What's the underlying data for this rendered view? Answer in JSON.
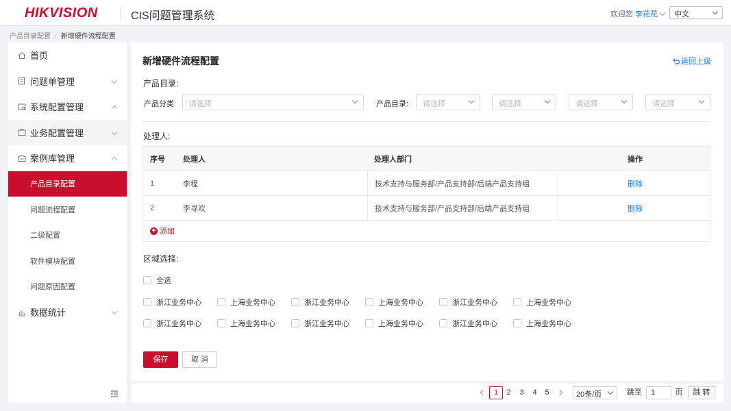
{
  "header": {
    "logo": "HIKVISION",
    "app_title": "CIS问题管理系统",
    "welcome": "欢迎您",
    "user": "李花花",
    "language": "中文"
  },
  "breadcrumb": [
    "产品目录配置",
    "新增硬件流程配置"
  ],
  "sidebar": {
    "items": [
      {
        "label": "首页",
        "icon": "home-icon"
      },
      {
        "label": "问题单管理",
        "icon": "ticket-icon"
      },
      {
        "label": "系统配置管理",
        "icon": "system-config-icon"
      },
      {
        "label": "业务配置管理",
        "icon": "business-config-icon"
      },
      {
        "label": "案例库管理",
        "icon": "case-library-icon"
      }
    ],
    "sub_items": [
      "产品目录配置",
      "问题流程配置",
      "二级配置",
      "软件模块配置",
      "问题原因配置"
    ],
    "stats": {
      "label": "数据统计",
      "icon": "chart-icon"
    }
  },
  "main": {
    "title": "新增硬件流程配置",
    "back": "返回上级",
    "product_dir_section": "产品目录:",
    "category_label": "产品分类:",
    "dir_label": "产品目录:",
    "placeholder": "请选择",
    "handler_section": "处理人:",
    "table": {
      "headers": [
        "序号",
        "处理人",
        "处理人部门",
        "操作"
      ],
      "rows": [
        {
          "no": "1",
          "name": "李程",
          "dept": "技术支持与服务部/产品支持部/后端产品支持组",
          "action": "删除"
        },
        {
          "no": "2",
          "name": "李寻欢",
          "dept": "技术支持与服务部/产品支持部/后端产品支持组",
          "action": "删除"
        }
      ],
      "add": "添加"
    },
    "region_section": "区域选择:",
    "select_all": "全选",
    "regions_row1": [
      "浙江业务中心",
      "上海业务中心",
      "浙江业务中心",
      "上海业务中心",
      "浙江业务中心",
      "上海业务中心"
    ],
    "regions_row2": [
      "浙江业务中心",
      "上海业务中心",
      "浙江业务中心",
      "上海业务中心",
      "浙江业务中心",
      "上海业务中心"
    ],
    "save": "保存",
    "cancel": "取 消"
  },
  "pagination": {
    "pages": [
      "1",
      "2",
      "3",
      "4",
      "5"
    ],
    "current": "1",
    "page_size": "20条/页",
    "jump_label": "跳至",
    "jump_value": "1",
    "page_unit": "页",
    "go": "跳 转"
  },
  "colors": {
    "brand": "#c8102e",
    "link": "#1677ff"
  }
}
